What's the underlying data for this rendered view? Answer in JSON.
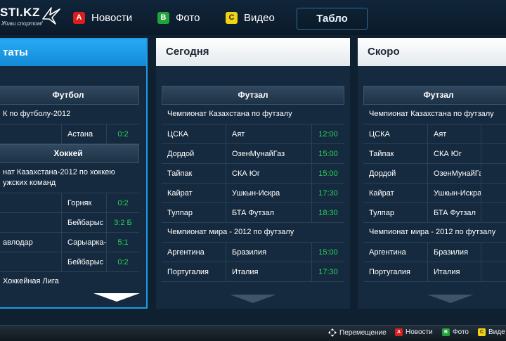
{
  "header": {
    "logo_text": "STI.KZ",
    "logo_slogan": "Живи спортом!",
    "nav": [
      {
        "key": "A",
        "label": "Новости"
      },
      {
        "key": "B",
        "label": "Фото"
      },
      {
        "key": "C",
        "label": "Видео"
      }
    ],
    "tablo_label": "Табло"
  },
  "panels": [
    {
      "title": "таты",
      "sections": [
        {
          "sport": "Футбол",
          "leagues": [
            {
              "name": "К по футболу-2012",
              "matches": [
                {
                  "home": "",
                  "away": "Астана",
                  "result": "0:2"
                }
              ]
            }
          ]
        },
        {
          "sport": "Хоккей",
          "leagues": [
            {
              "name": "нат Казахстана-2012 по хоккею\nужских команд",
              "matches": [
                {
                  "home": "",
                  "away": "Горняк",
                  "result": "0:2"
                },
                {
                  "home": "",
                  "away": "Бейбарыс",
                  "result": "3:2 Б"
                },
                {
                  "home": "авлодар",
                  "away": "Сарыарка-2",
                  "result": "5:1"
                },
                {
                  "home": "",
                  "away": "Бейбарыс",
                  "result": "0:2"
                }
              ]
            },
            {
              "name": "Хоккейная Лига",
              "matches": []
            }
          ]
        }
      ]
    },
    {
      "title": "Сегодня",
      "sections": [
        {
          "sport": "Футзал",
          "leagues": [
            {
              "name": "Чемпионат Казахстана по футзалу",
              "matches": [
                {
                  "home": "ЦСКА",
                  "away": "Аят",
                  "result": "12:00"
                },
                {
                  "home": "Дордой",
                  "away": "ОзенМунайГаз",
                  "result": "15:00"
                },
                {
                  "home": "Тайпак",
                  "away": "СКА Юг",
                  "result": "15:00"
                },
                {
                  "home": "Кайрат",
                  "away": "Ушкын-Искра",
                  "result": "17:30"
                },
                {
                  "home": "Тулпар",
                  "away": "БТА Футзал",
                  "result": "18:30"
                }
              ]
            },
            {
              "name": "Чемпионат мира - 2012 по футзалу",
              "matches": [
                {
                  "home": "Аргентина",
                  "away": "Бразилия",
                  "result": "15:00"
                },
                {
                  "home": "Португалия",
                  "away": "Италия",
                  "result": "17:30"
                }
              ]
            }
          ]
        }
      ]
    },
    {
      "title": "Скоро",
      "sections": [
        {
          "sport": "Футзал",
          "leagues": [
            {
              "name": "Чемпионат Казахстана по футзалу",
              "matches": [
                {
                  "home": "ЦСКА",
                  "away": "Аят",
                  "result": ""
                },
                {
                  "home": "Тайпак",
                  "away": "СКА Юг",
                  "result": ""
                },
                {
                  "home": "Дордой",
                  "away": "ОзенМунайГаз",
                  "result": ""
                },
                {
                  "home": "Кайрат",
                  "away": "Ушкын-Искра",
                  "result": ""
                },
                {
                  "home": "Тулпар",
                  "away": "БТА Футзал",
                  "result": ""
                }
              ]
            },
            {
              "name": "Чемпионат мира - 2012 по футзалу",
              "matches": [
                {
                  "home": "Аргентина",
                  "away": "Бразилия",
                  "result": ""
                },
                {
                  "home": "Португалия",
                  "away": "Италия",
                  "result": ""
                }
              ]
            }
          ]
        }
      ]
    }
  ],
  "footer": [
    {
      "icon": "dpad-icon",
      "key": "",
      "label": "Перемещение"
    },
    {
      "icon": "",
      "key": "A",
      "label": "Новости"
    },
    {
      "icon": "",
      "key": "B",
      "label": "Фото"
    },
    {
      "icon": "",
      "key": "C",
      "label": "Виде"
    }
  ],
  "colors": {
    "accent": "#1e9be8",
    "result_green": "#27d35a",
    "key_red": "#d91e1e",
    "key_green": "#1fa33a",
    "key_yellow": "#f2d313"
  }
}
